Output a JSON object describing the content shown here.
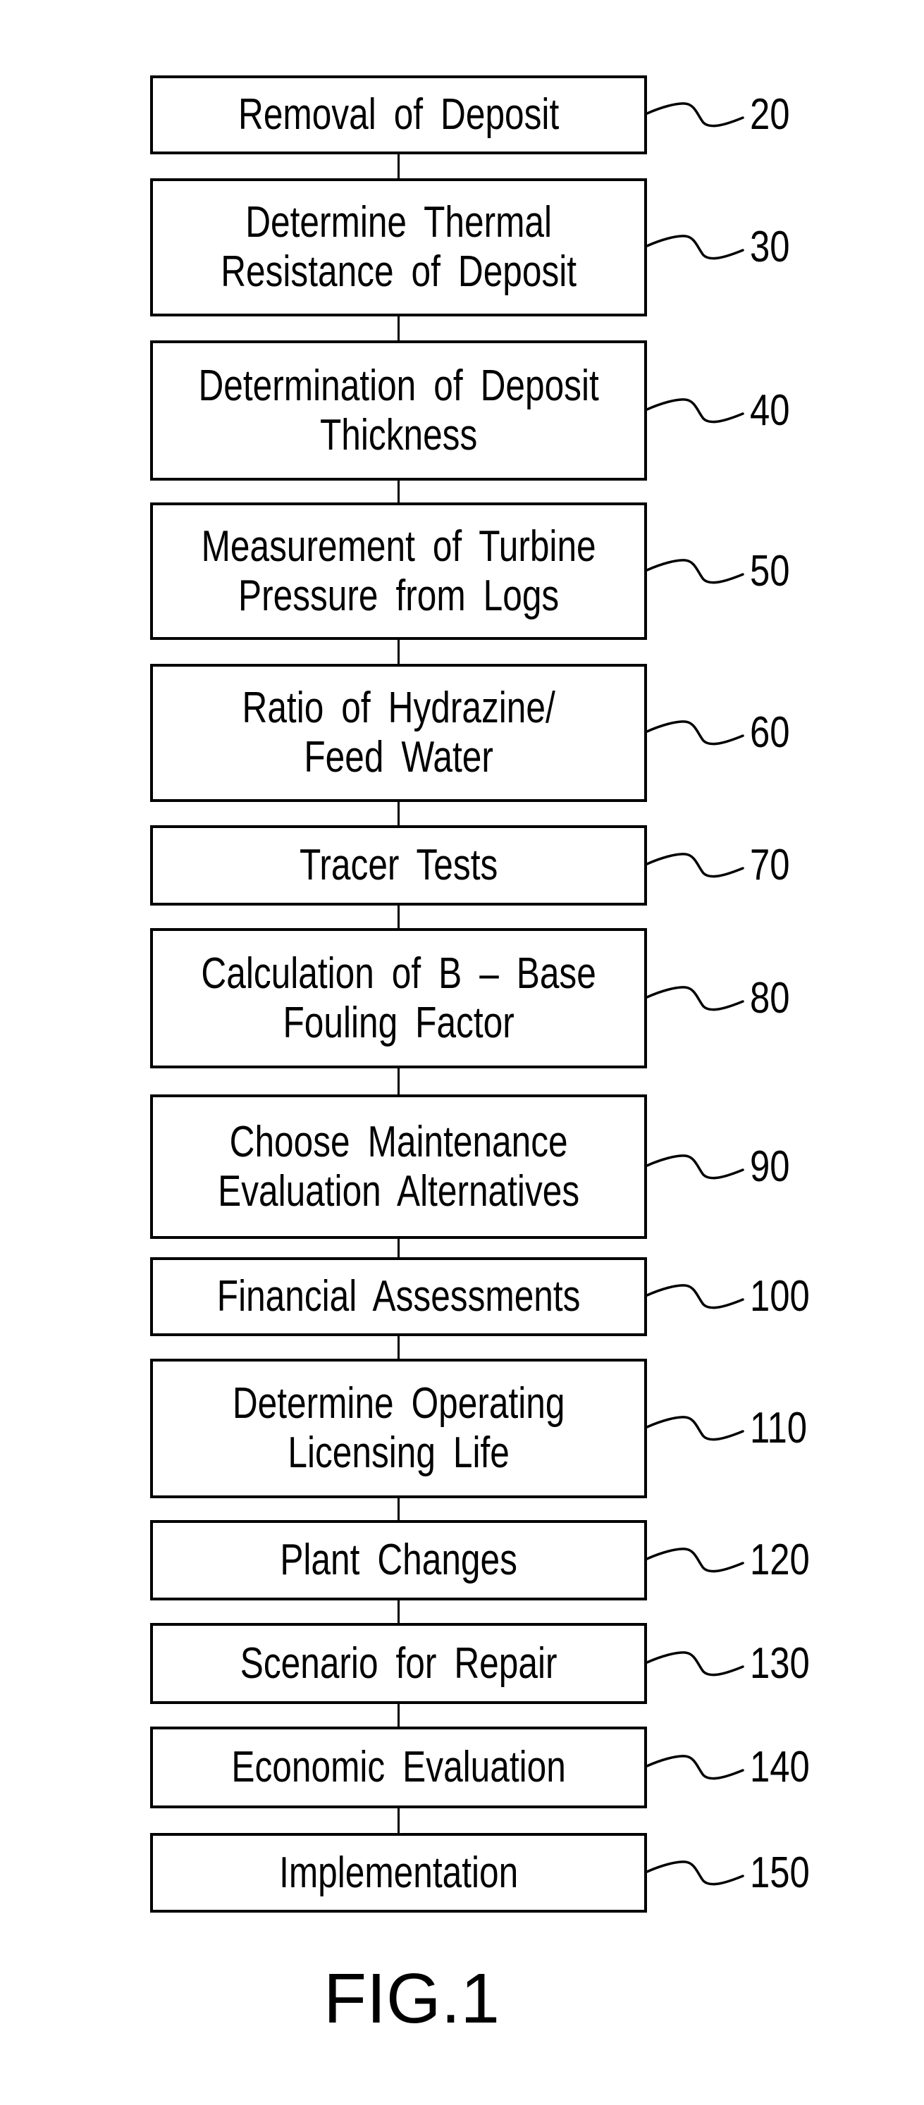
{
  "figure": {
    "caption": "FIG.1",
    "steps": [
      {
        "ref": "20",
        "label": "Removal of Deposit"
      },
      {
        "ref": "30",
        "label": "Determine Thermal\nResistance of Deposit"
      },
      {
        "ref": "40",
        "label": "Determination of Deposit\nThickness"
      },
      {
        "ref": "50",
        "label": "Measurement of Turbine\nPressure from Logs"
      },
      {
        "ref": "60",
        "label": "Ratio of Hydrazine/\nFeed Water"
      },
      {
        "ref": "70",
        "label": "Tracer Tests"
      },
      {
        "ref": "80",
        "label": "Calculation of B – Base\nFouling Factor"
      },
      {
        "ref": "90",
        "label": "Choose Maintenance\nEvaluation Alternatives"
      },
      {
        "ref": "100",
        "label": "Financial Assessments"
      },
      {
        "ref": "110",
        "label": "Determine Operating\nLicensing Life"
      },
      {
        "ref": "120",
        "label": "Plant Changes"
      },
      {
        "ref": "130",
        "label": "Scenario for Repair"
      },
      {
        "ref": "140",
        "label": "Economic Evaluation"
      },
      {
        "ref": "150",
        "label": "Implementation"
      }
    ]
  }
}
